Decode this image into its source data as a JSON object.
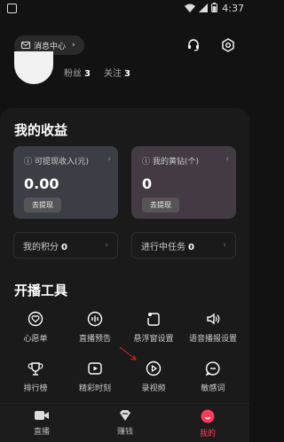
{
  "status": {
    "time": "4:37"
  },
  "header": {
    "message_center_label": "消息中心"
  },
  "profile": {
    "fans_label": "粉丝",
    "fans_count": "3",
    "follow_label": "关注",
    "follow_count": "3"
  },
  "earnings": {
    "title": "我的收益",
    "cards": [
      {
        "label": "可提现收入(元)",
        "value": "0.00",
        "button": "去提现"
      },
      {
        "label": "我的黄钻(个)",
        "value": "0",
        "button": "去提现"
      }
    ],
    "points_label": "我的积分",
    "points_value": "0",
    "tasks_label": "进行中任务",
    "tasks_value": "0"
  },
  "tools": {
    "title": "开播工具",
    "items": [
      {
        "label": "心愿单",
        "icon": "heart-icon"
      },
      {
        "label": "直播预告",
        "icon": "preview-icon"
      },
      {
        "label": "悬浮窗设置",
        "icon": "floating-window-icon"
      },
      {
        "label": "语音播报设置",
        "icon": "speaker-icon"
      },
      {
        "label": "排行榜",
        "icon": "trophy-icon"
      },
      {
        "label": "精彩时刻",
        "icon": "highlight-icon"
      },
      {
        "label": "录视频",
        "icon": "record-video-icon"
      },
      {
        "label": "敏感词",
        "icon": "sensitive-word-icon"
      }
    ]
  },
  "tabbar": {
    "items": [
      {
        "label": "直播",
        "icon": "live-icon"
      },
      {
        "label": "赚钱",
        "icon": "earn-icon"
      },
      {
        "label": "我的",
        "icon": "profile-icon"
      }
    ],
    "active_color": "#ff3a5c"
  },
  "colors": {
    "background": "#121212",
    "panel": "#1a1a1a",
    "accent": "#ff3a5c"
  }
}
